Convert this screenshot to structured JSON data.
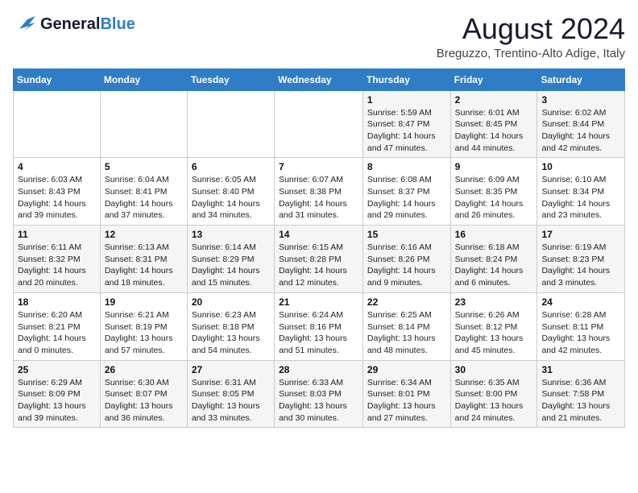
{
  "header": {
    "logo_general": "General",
    "logo_blue": "Blue",
    "month_year": "August 2024",
    "location": "Breguzzo, Trentino-Alto Adige, Italy"
  },
  "weekdays": [
    "Sunday",
    "Monday",
    "Tuesday",
    "Wednesday",
    "Thursday",
    "Friday",
    "Saturday"
  ],
  "weeks": [
    [
      {
        "day": "",
        "info": ""
      },
      {
        "day": "",
        "info": ""
      },
      {
        "day": "",
        "info": ""
      },
      {
        "day": "",
        "info": ""
      },
      {
        "day": "1",
        "info": "Sunrise: 5:59 AM\nSunset: 8:47 PM\nDaylight: 14 hours and 47 minutes."
      },
      {
        "day": "2",
        "info": "Sunrise: 6:01 AM\nSunset: 8:45 PM\nDaylight: 14 hours and 44 minutes."
      },
      {
        "day": "3",
        "info": "Sunrise: 6:02 AM\nSunset: 8:44 PM\nDaylight: 14 hours and 42 minutes."
      }
    ],
    [
      {
        "day": "4",
        "info": "Sunrise: 6:03 AM\nSunset: 8:43 PM\nDaylight: 14 hours and 39 minutes."
      },
      {
        "day": "5",
        "info": "Sunrise: 6:04 AM\nSunset: 8:41 PM\nDaylight: 14 hours and 37 minutes."
      },
      {
        "day": "6",
        "info": "Sunrise: 6:05 AM\nSunset: 8:40 PM\nDaylight: 14 hours and 34 minutes."
      },
      {
        "day": "7",
        "info": "Sunrise: 6:07 AM\nSunset: 8:38 PM\nDaylight: 14 hours and 31 minutes."
      },
      {
        "day": "8",
        "info": "Sunrise: 6:08 AM\nSunset: 8:37 PM\nDaylight: 14 hours and 29 minutes."
      },
      {
        "day": "9",
        "info": "Sunrise: 6:09 AM\nSunset: 8:35 PM\nDaylight: 14 hours and 26 minutes."
      },
      {
        "day": "10",
        "info": "Sunrise: 6:10 AM\nSunset: 8:34 PM\nDaylight: 14 hours and 23 minutes."
      }
    ],
    [
      {
        "day": "11",
        "info": "Sunrise: 6:11 AM\nSunset: 8:32 PM\nDaylight: 14 hours and 20 minutes."
      },
      {
        "day": "12",
        "info": "Sunrise: 6:13 AM\nSunset: 8:31 PM\nDaylight: 14 hours and 18 minutes."
      },
      {
        "day": "13",
        "info": "Sunrise: 6:14 AM\nSunset: 8:29 PM\nDaylight: 14 hours and 15 minutes."
      },
      {
        "day": "14",
        "info": "Sunrise: 6:15 AM\nSunset: 8:28 PM\nDaylight: 14 hours and 12 minutes."
      },
      {
        "day": "15",
        "info": "Sunrise: 6:16 AM\nSunset: 8:26 PM\nDaylight: 14 hours and 9 minutes."
      },
      {
        "day": "16",
        "info": "Sunrise: 6:18 AM\nSunset: 8:24 PM\nDaylight: 14 hours and 6 minutes."
      },
      {
        "day": "17",
        "info": "Sunrise: 6:19 AM\nSunset: 8:23 PM\nDaylight: 14 hours and 3 minutes."
      }
    ],
    [
      {
        "day": "18",
        "info": "Sunrise: 6:20 AM\nSunset: 8:21 PM\nDaylight: 14 hours and 0 minutes."
      },
      {
        "day": "19",
        "info": "Sunrise: 6:21 AM\nSunset: 8:19 PM\nDaylight: 13 hours and 57 minutes."
      },
      {
        "day": "20",
        "info": "Sunrise: 6:23 AM\nSunset: 8:18 PM\nDaylight: 13 hours and 54 minutes."
      },
      {
        "day": "21",
        "info": "Sunrise: 6:24 AM\nSunset: 8:16 PM\nDaylight: 13 hours and 51 minutes."
      },
      {
        "day": "22",
        "info": "Sunrise: 6:25 AM\nSunset: 8:14 PM\nDaylight: 13 hours and 48 minutes."
      },
      {
        "day": "23",
        "info": "Sunrise: 6:26 AM\nSunset: 8:12 PM\nDaylight: 13 hours and 45 minutes."
      },
      {
        "day": "24",
        "info": "Sunrise: 6:28 AM\nSunset: 8:11 PM\nDaylight: 13 hours and 42 minutes."
      }
    ],
    [
      {
        "day": "25",
        "info": "Sunrise: 6:29 AM\nSunset: 8:09 PM\nDaylight: 13 hours and 39 minutes."
      },
      {
        "day": "26",
        "info": "Sunrise: 6:30 AM\nSunset: 8:07 PM\nDaylight: 13 hours and 36 minutes."
      },
      {
        "day": "27",
        "info": "Sunrise: 6:31 AM\nSunset: 8:05 PM\nDaylight: 13 hours and 33 minutes."
      },
      {
        "day": "28",
        "info": "Sunrise: 6:33 AM\nSunset: 8:03 PM\nDaylight: 13 hours and 30 minutes."
      },
      {
        "day": "29",
        "info": "Sunrise: 6:34 AM\nSunset: 8:01 PM\nDaylight: 13 hours and 27 minutes."
      },
      {
        "day": "30",
        "info": "Sunrise: 6:35 AM\nSunset: 8:00 PM\nDaylight: 13 hours and 24 minutes."
      },
      {
        "day": "31",
        "info": "Sunrise: 6:36 AM\nSunset: 7:58 PM\nDaylight: 13 hours and 21 minutes."
      }
    ]
  ]
}
